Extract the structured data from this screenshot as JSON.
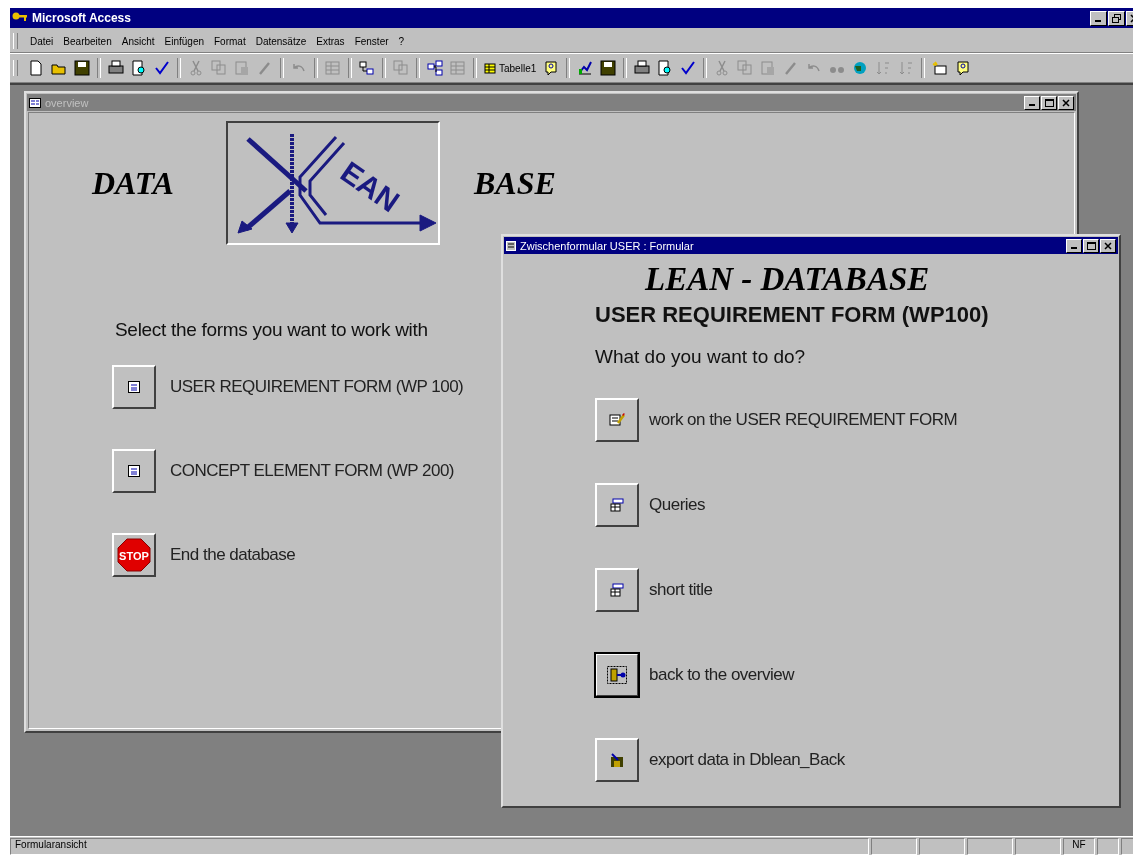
{
  "app": {
    "title": "Microsoft Access"
  },
  "menu": [
    {
      "label": "Datei"
    },
    {
      "label": "Bearbeiten"
    },
    {
      "label": "Ansicht"
    },
    {
      "label": "Einfügen"
    },
    {
      "label": "Format"
    },
    {
      "label": "Datensätze"
    },
    {
      "label": "Extras"
    },
    {
      "label": "Fenster"
    },
    {
      "label": "?"
    }
  ],
  "toolbar": {
    "table_button": "Tabelle1"
  },
  "overview": {
    "title": "overview",
    "active": false,
    "logo_left": "DATA",
    "logo_text": "EAN",
    "logo_right": "BASE",
    "prompt": "Select the forms you want to work with",
    "buttons": [
      {
        "kind": "form",
        "label": "USER REQUIREMENT FORM (WP 100)"
      },
      {
        "kind": "form",
        "label": "CONCEPT ELEMENT FORM (WP 200)"
      },
      {
        "kind": "stop",
        "label": "End the database",
        "icon_text": "STOP"
      }
    ]
  },
  "popup": {
    "title": "Zwischenformular USER : Formular",
    "active": true,
    "heading": "LEAN - DATABASE",
    "subheading": "USER REQUIREMENT FORM (WP100)",
    "prompt": "What do you want to do?",
    "buttons": [
      {
        "kind": "edit",
        "label": "work on the USER REQUIREMENT FORM",
        "focused": false
      },
      {
        "kind": "query",
        "label": "Queries",
        "focused": false
      },
      {
        "kind": "query",
        "label": "short title",
        "focused": false
      },
      {
        "kind": "exit",
        "label": "back to the overview",
        "focused": true
      },
      {
        "kind": "export",
        "label": "export data in Dblean_Back",
        "focused": false
      }
    ]
  },
  "status_bar": {
    "text": "Formularansicht",
    "indicators": [
      "NF"
    ]
  }
}
